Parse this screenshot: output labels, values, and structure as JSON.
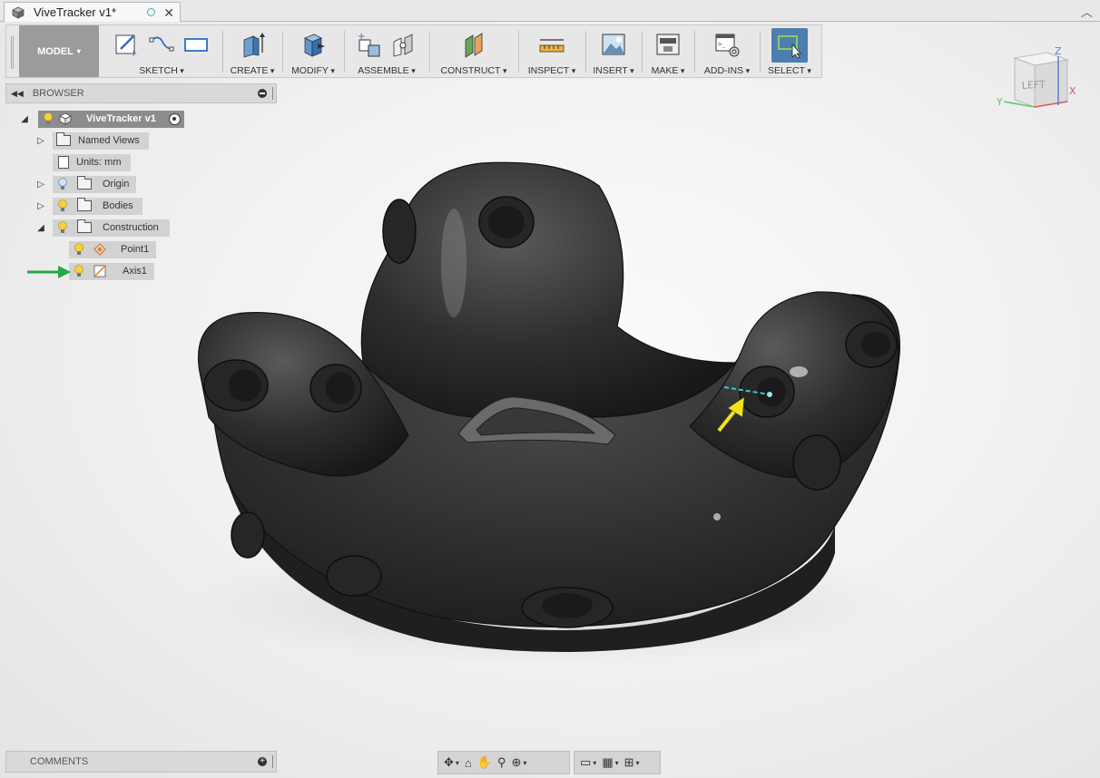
{
  "window": {
    "tab_title": "ViveTracker v1*"
  },
  "toolbar": {
    "workspace": "MODEL",
    "groups": [
      {
        "label": "SKETCH"
      },
      {
        "label": "CREATE"
      },
      {
        "label": "MODIFY"
      },
      {
        "label": "ASSEMBLE"
      },
      {
        "label": "CONSTRUCT"
      },
      {
        "label": "INSPECT"
      },
      {
        "label": "INSERT"
      },
      {
        "label": "MAKE"
      },
      {
        "label": "ADD-INS"
      },
      {
        "label": "SELECT"
      }
    ]
  },
  "browser": {
    "title": "BROWSER",
    "root": "ViveTracker v1",
    "items": [
      {
        "label": "Named Views",
        "icon": "folder-icon"
      },
      {
        "label": "Units: mm",
        "icon": "document-icon"
      },
      {
        "label": "Origin",
        "icon": "folder-icon"
      },
      {
        "label": "Bodies",
        "icon": "folder-icon"
      },
      {
        "label": "Construction",
        "icon": "folder-icon"
      },
      {
        "label": "Point1",
        "icon": "point-icon"
      },
      {
        "label": "Axis1",
        "icon": "axis-icon"
      }
    ]
  },
  "comments": {
    "title": "COMMENTS"
  },
  "viewcube": {
    "face": "LEFT",
    "axes": {
      "x": "X",
      "y": "Y",
      "z": "Z"
    }
  },
  "colors": {
    "accent_select": "#4d7fae",
    "model_body": "#2e2e2e",
    "annotation_green": "#23a84a",
    "annotation_yellow": "#f2e21b",
    "axis_line": "#3cc7d4"
  }
}
